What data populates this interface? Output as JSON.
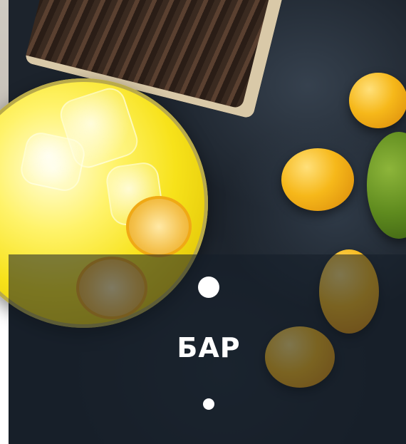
{
  "hero": {
    "title": "БАР",
    "image": "cocktail-with-kumquats-photo"
  },
  "colors": {
    "overlay": "#141e28",
    "title": "#ffffff",
    "dots": "#ffffff"
  },
  "icons": {
    "top": "dot-icon",
    "bottom": "dot-icon"
  }
}
